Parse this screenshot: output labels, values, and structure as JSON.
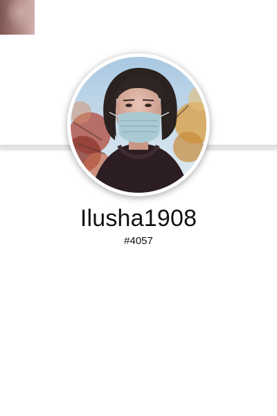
{
  "profile": {
    "username": "Ilusha1908",
    "tag": "#4057"
  },
  "icons": {
    "avatar": "avatar-photo",
    "thumbnail": "thumbnail-image"
  },
  "colors": {
    "background": "#ffffff",
    "text": "#111111",
    "divider": "#d7d7d7"
  }
}
